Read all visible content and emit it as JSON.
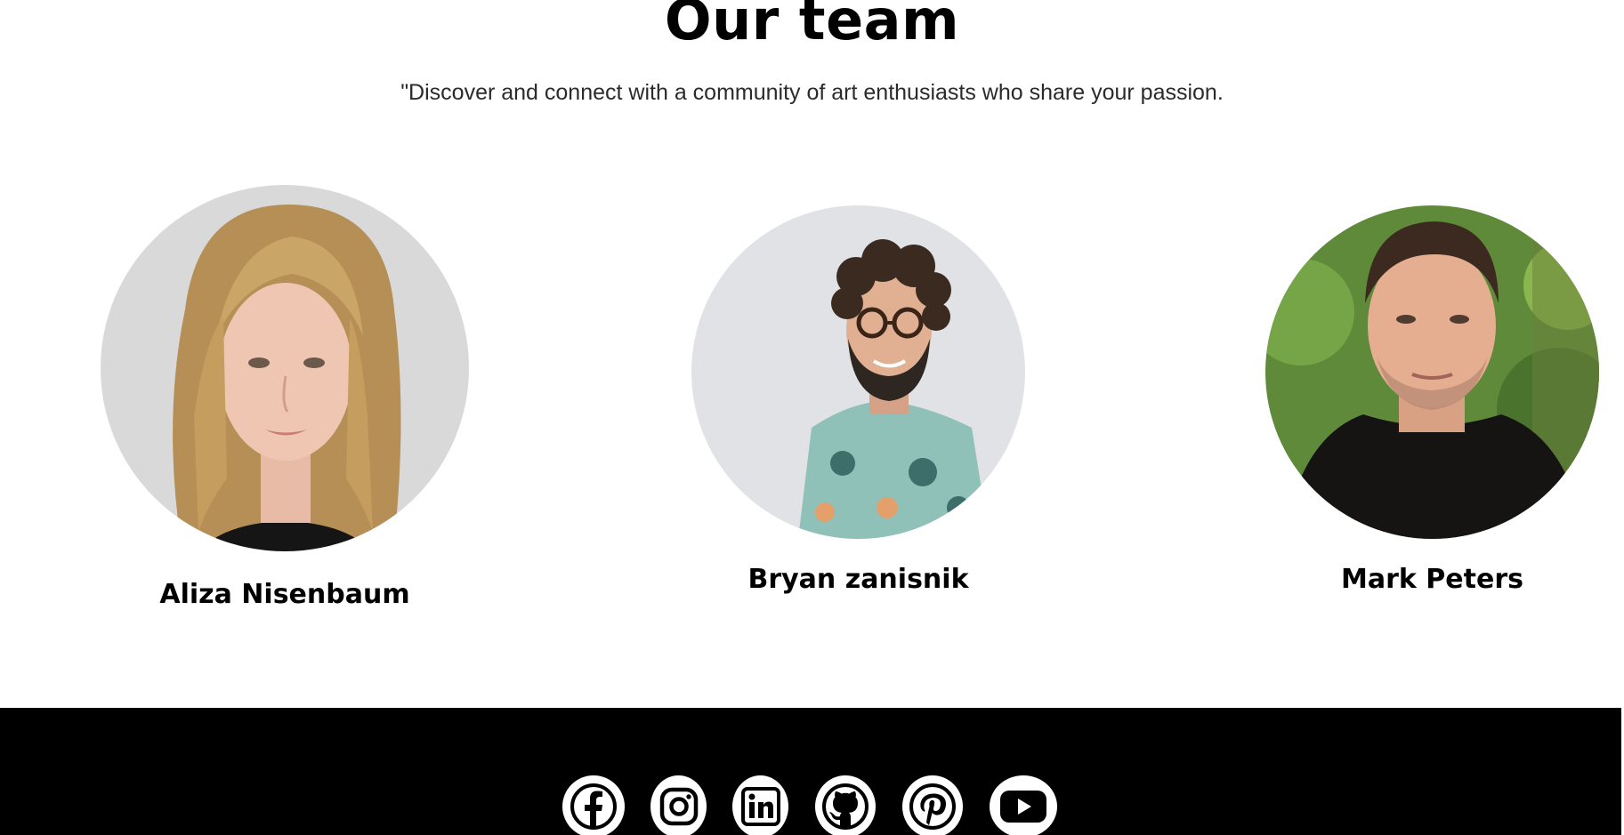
{
  "section": {
    "title": "Our team",
    "subtitle": "\"Discover and connect with a community of art enthusiasts who share your passion."
  },
  "team": [
    {
      "name": "Aliza Nisenbaum",
      "photo": "avatar-woman-blonde"
    },
    {
      "name": "Bryan zanisnik",
      "photo": "avatar-man-curly-glasses"
    },
    {
      "name": "Mark Peters",
      "photo": "avatar-man-black-tshirt"
    }
  ],
  "footer": {
    "social_icons": [
      "facebook-icon",
      "instagram-icon",
      "linkedin-icon",
      "github-icon",
      "pinterest-icon",
      "youtube-icon"
    ],
    "background": "#000000",
    "icon_color": "#ffffff"
  }
}
